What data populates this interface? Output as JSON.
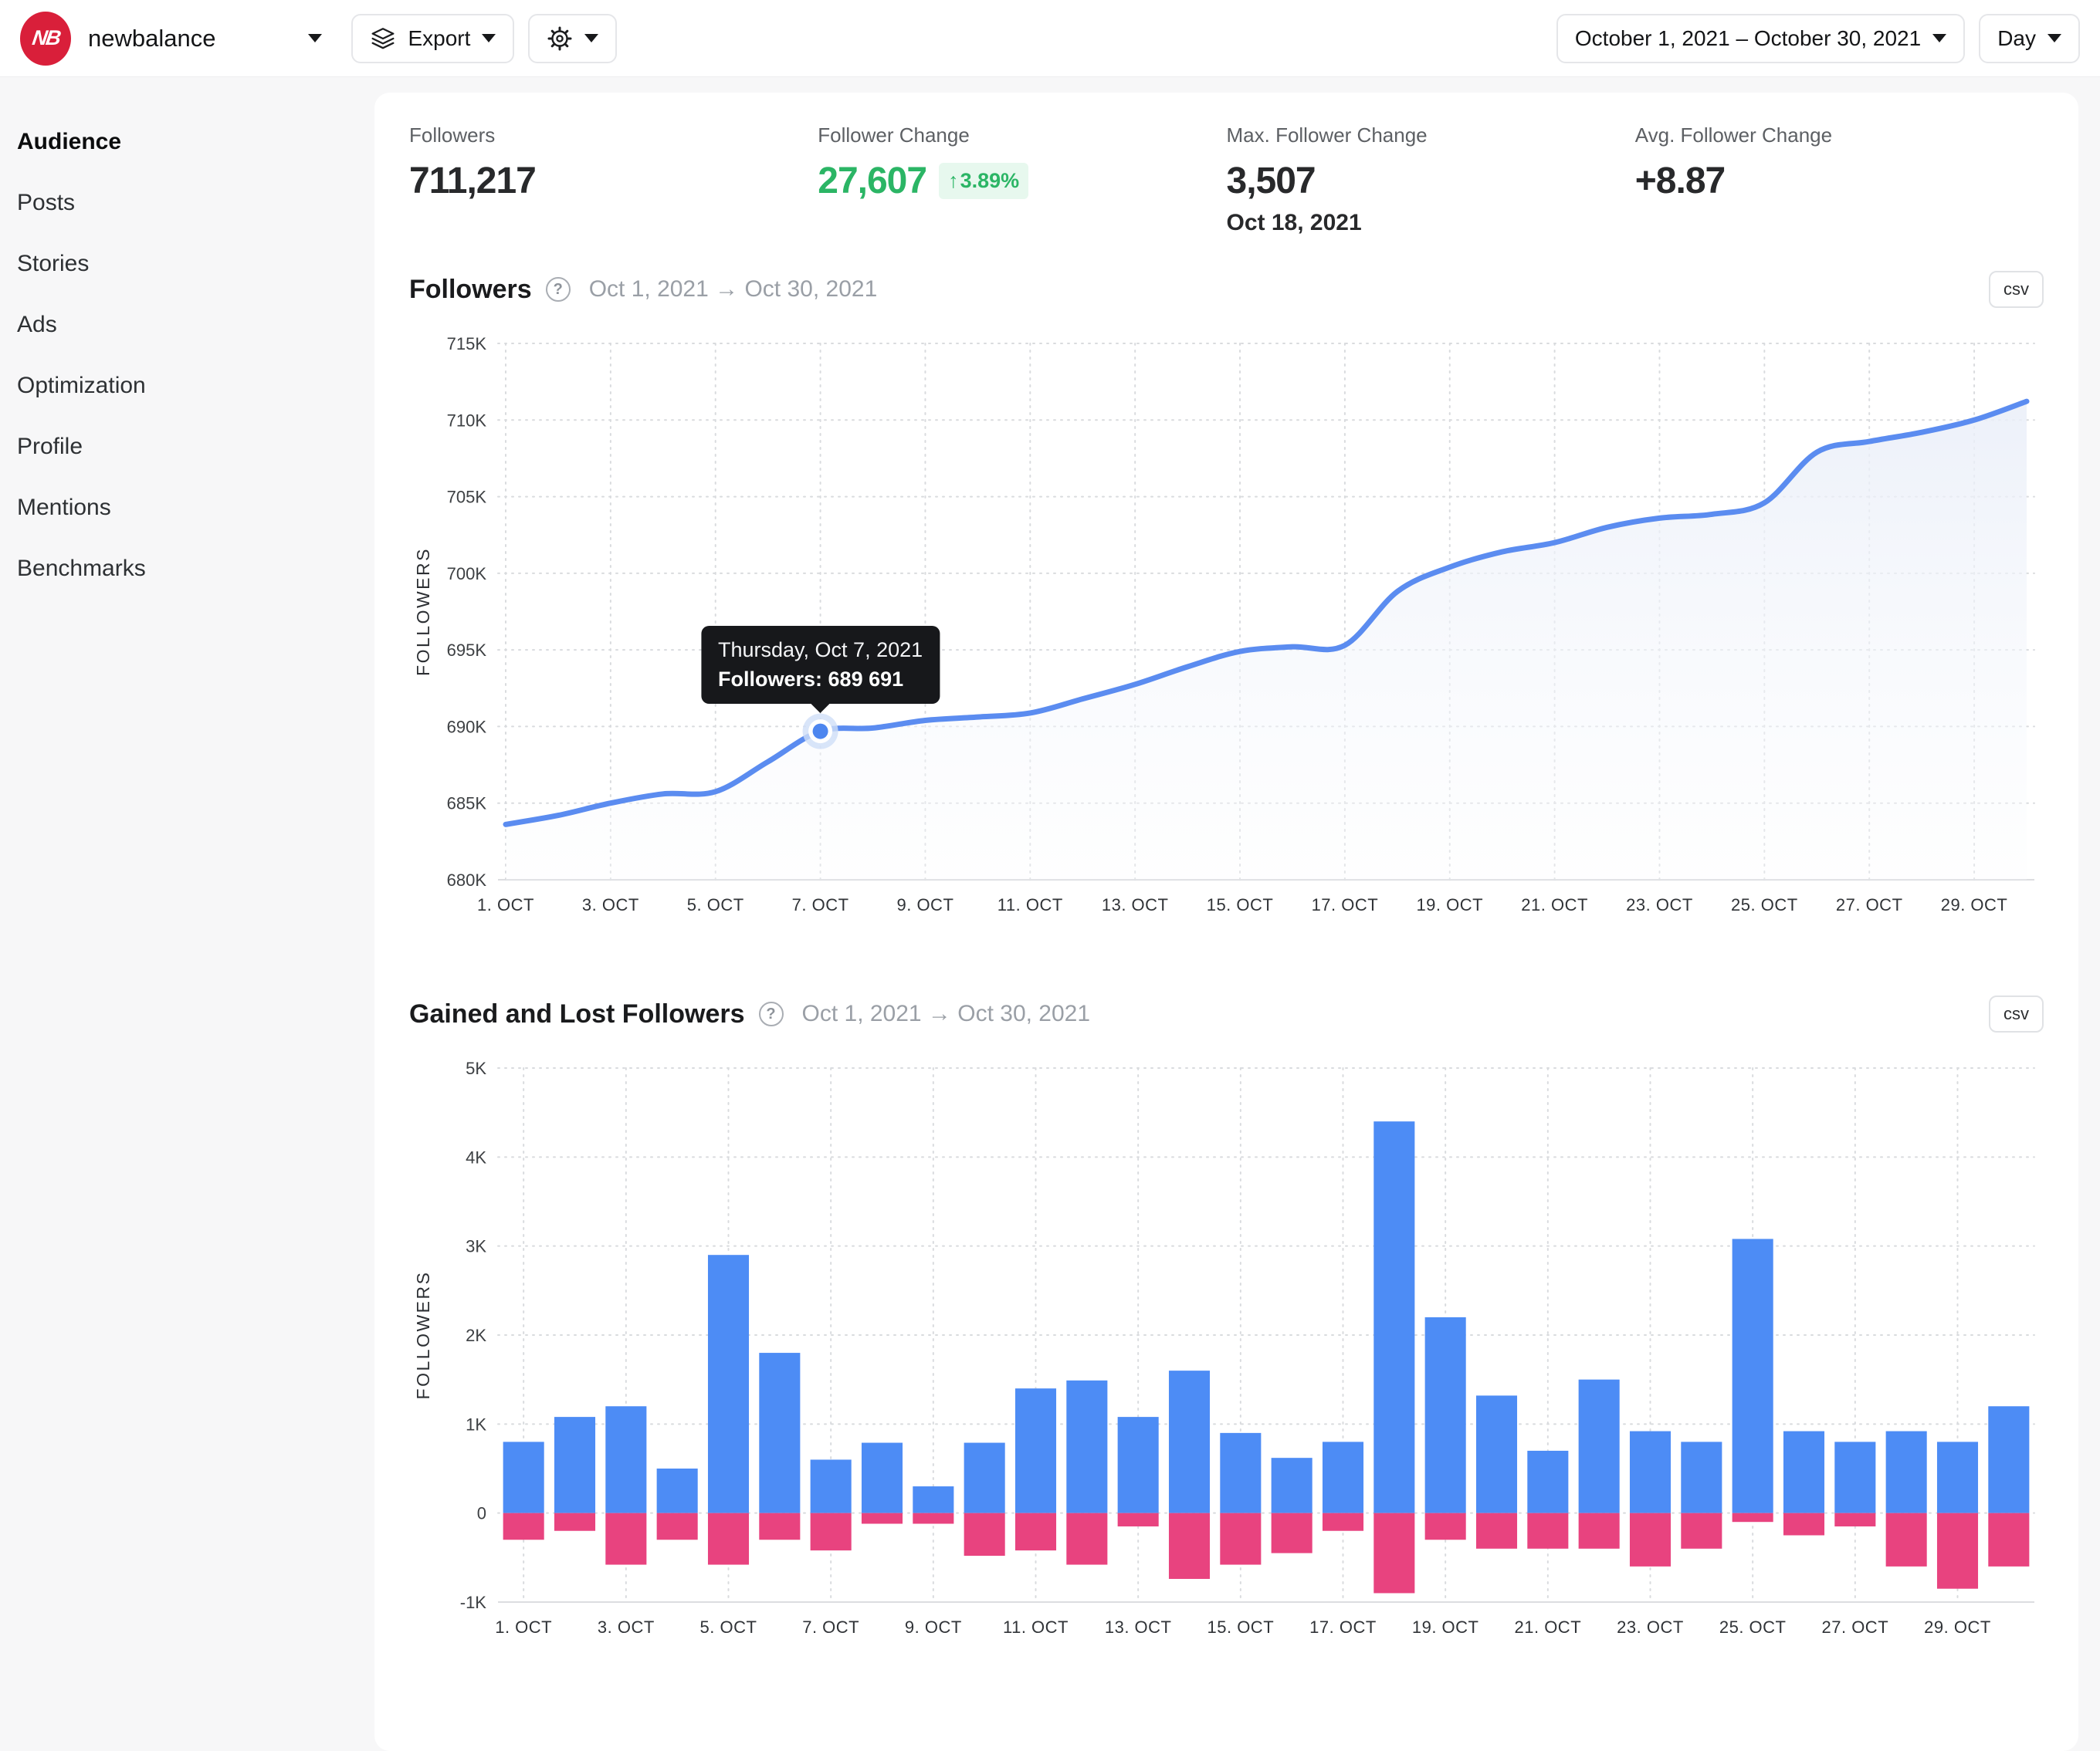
{
  "header": {
    "account_name": "newbalance",
    "logo_text": "NB",
    "logo_color": "#d91f3a",
    "export_button": {
      "label": "Export"
    },
    "date_range_button": {
      "label": "October 1, 2021 – October 30, 2021"
    },
    "granularity_button": {
      "label": "Day"
    }
  },
  "sidebar": {
    "items": [
      {
        "label": "Audience",
        "active": true
      },
      {
        "label": "Posts",
        "active": false
      },
      {
        "label": "Stories",
        "active": false
      },
      {
        "label": "Ads",
        "active": false
      },
      {
        "label": "Optimization",
        "active": false
      },
      {
        "label": "Profile",
        "active": false
      },
      {
        "label": "Mentions",
        "active": false
      },
      {
        "label": "Benchmarks",
        "active": false
      }
    ]
  },
  "stats": {
    "followers": {
      "label": "Followers",
      "value": "711,217"
    },
    "change": {
      "label": "Follower Change",
      "value": "27,607",
      "badge_arrow": "↑",
      "badge_pct": "3.89%",
      "color": "#2bb565"
    },
    "max_change": {
      "label": "Max. Follower Change",
      "value": "3,507",
      "date": "Oct 18, 2021"
    },
    "avg_change": {
      "label": "Avg. Follower Change",
      "value": "+8.87"
    }
  },
  "followers_chart": {
    "title": "Followers",
    "date_range": "Oct 1, 2021 → Oct 30, 2021",
    "csv_label": "csv",
    "tooltip": {
      "title": "Thursday, Oct 7, 2021",
      "label": "Followers:",
      "value": "689 691"
    }
  },
  "gained_lost_chart": {
    "title": "Gained and Lost Followers",
    "date_range": "Oct 1, 2021 → Oct 30, 2021",
    "csv_label": "csv"
  },
  "chart_data": [
    {
      "type": "line",
      "title": "Followers",
      "ylabel": "FOLLOWERS",
      "ylim": [
        680000,
        715000
      ],
      "y_tick_step": 5000,
      "y_tick_labels": [
        "715K",
        "710K",
        "705K",
        "700K",
        "695K",
        "690K",
        "685K",
        "680K"
      ],
      "x_tick_labels": [
        "1. OCT",
        "3. OCT",
        "5. OCT",
        "7. OCT",
        "9. OCT",
        "11. OCT",
        "13. OCT",
        "15. OCT",
        "17. OCT",
        "19. OCT",
        "21. OCT",
        "23. OCT",
        "25. OCT",
        "27. OCT",
        "29. OCT"
      ],
      "days": [
        1,
        2,
        3,
        4,
        5,
        6,
        7,
        8,
        9,
        10,
        11,
        12,
        13,
        14,
        15,
        16,
        17,
        18,
        19,
        20,
        21,
        22,
        23,
        24,
        25,
        26,
        27,
        28,
        29,
        30
      ],
      "values": [
        683610,
        684200,
        685000,
        685600,
        685750,
        687700,
        689691,
        689900,
        690400,
        690620,
        690880,
        691800,
        692750,
        693900,
        694900,
        695200,
        695300,
        698807,
        700400,
        701400,
        702000,
        703000,
        703600,
        703850,
        704600,
        707900,
        708600,
        709200,
        710000,
        711217
      ],
      "line_color": "#5b8cf0",
      "grid": true,
      "legend": "none",
      "highlight": {
        "day": 7,
        "value": 689691
      }
    },
    {
      "type": "bar",
      "title": "Gained and Lost Followers",
      "ylabel": "FOLLOWERS",
      "ylim": [
        -1000,
        5000
      ],
      "y_tick_step": 1000,
      "y_tick_labels": [
        "5K",
        "4K",
        "3K",
        "2K",
        "1K",
        "0",
        "-1K"
      ],
      "x_tick_labels": [
        "1. OCT",
        "3. OCT",
        "5. OCT",
        "7. OCT",
        "9. OCT",
        "11. OCT",
        "13. OCT",
        "15. OCT",
        "17. OCT",
        "19. OCT",
        "21. OCT",
        "23. OCT",
        "25. OCT",
        "27. OCT",
        "29. OCT"
      ],
      "days": [
        1,
        2,
        3,
        4,
        5,
        6,
        7,
        8,
        9,
        10,
        11,
        12,
        13,
        14,
        15,
        16,
        17,
        18,
        19,
        20,
        21,
        22,
        23,
        24,
        25,
        26,
        27,
        28,
        29,
        30
      ],
      "series": [
        {
          "name": "Gained",
          "color": "#4d8cf5",
          "values": [
            800,
            1080,
            1200,
            500,
            2900,
            1800,
            600,
            790,
            300,
            790,
            1400,
            1490,
            1080,
            1600,
            900,
            620,
            800,
            4400,
            2200,
            1320,
            700,
            1500,
            920,
            800,
            3080,
            920,
            800,
            920,
            800,
            1200
          ]
        },
        {
          "name": "Lost",
          "color": "#e8437f",
          "values": [
            -300,
            -200,
            -580,
            -300,
            -580,
            -300,
            -420,
            -120,
            -120,
            -480,
            -420,
            -580,
            -150,
            -740,
            -580,
            -450,
            -200,
            -900,
            -300,
            -400,
            -400,
            -400,
            -600,
            -400,
            -100,
            -250,
            -150,
            -600,
            -850,
            -600
          ]
        }
      ],
      "grid": true,
      "legend": "none"
    }
  ]
}
